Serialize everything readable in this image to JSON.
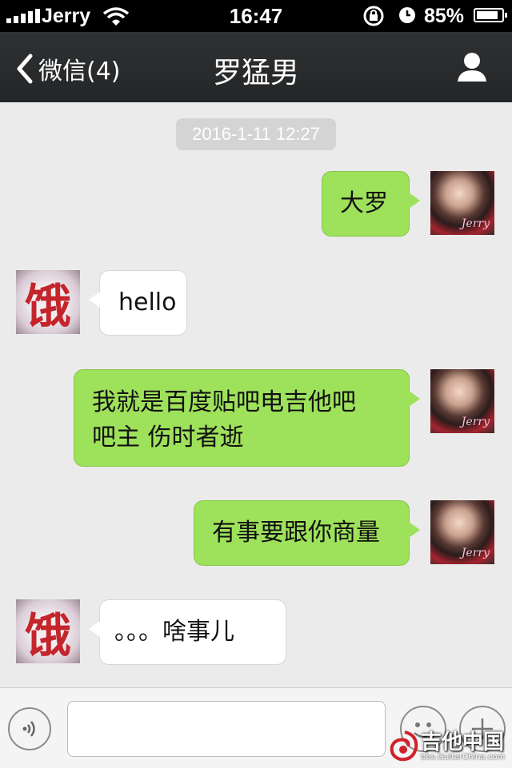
{
  "status_bar": {
    "carrier": "Jerry",
    "time": "16:47",
    "battery_percent": "85%",
    "battery_level": 0.85
  },
  "nav": {
    "back_label": "微信(4)",
    "title": "罗猛男",
    "back_icon": "chevron-left-icon",
    "profile_icon": "person-icon"
  },
  "chat": {
    "timestamp": "2016-1-11 12:27",
    "messages": [
      {
        "from": "me",
        "lines": [
          "大罗"
        ]
      },
      {
        "from": "them",
        "lines": [
          "hello"
        ]
      },
      {
        "from": "me",
        "lines": [
          "我就是百度贴吧电吉他吧",
          "吧主 伤时者逝"
        ]
      },
      {
        "from": "me",
        "lines": [
          "有事要跟你商量"
        ]
      },
      {
        "from": "them",
        "lines": [
          "。。。啥事儿"
        ]
      }
    ],
    "my_avatar_signature": "Jerry",
    "their_avatar_char": "饿"
  },
  "input_bar": {
    "voice_icon": "voice-icon",
    "emoji_icon": "emoji-icon",
    "plus_icon": "plus-icon",
    "message_text": ""
  },
  "watermark": {
    "title": "吉他中国",
    "url": "bbs.GuitarChina.com"
  },
  "colors": {
    "my_bubble": "#9ee15b",
    "their_bubble": "#ffffff",
    "nav_bg": "#2a2c2e",
    "chat_bg": "#ebebeb"
  }
}
